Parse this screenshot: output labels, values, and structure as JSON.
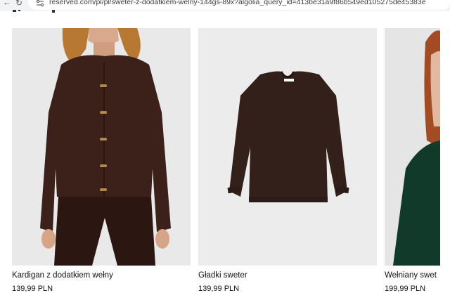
{
  "browser": {
    "url": "reserved.com/pl/pl/sweter-z-dodatkiem-welny-144gs-89x?algolia_query_id=413be31a9f86b549ed105275de45383e",
    "reload_icon": "reload-icon",
    "site_info_icon": "site-info-icon"
  },
  "products": [
    {
      "title": "Kardigan z dodatkiem wełny",
      "price": "139,99 PLN",
      "image_icon": "brown-cardigan-model-photo"
    },
    {
      "title": "Gładki sweter",
      "price": "139,99 PLN",
      "image_icon": "brown-sweater-flatlay-photo"
    },
    {
      "title": "Wełniany swet",
      "price": "199,99 PLN",
      "image_icon": "green-sweater-model-photo"
    }
  ],
  "colors": {
    "cardigan_brown": "#3b2119",
    "sweater_brown": "#34201b",
    "green_sweater": "#113a2b",
    "image_bg": "#ebebeb"
  }
}
